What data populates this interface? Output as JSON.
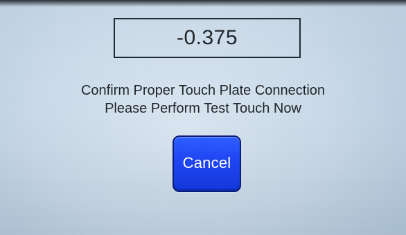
{
  "display": {
    "value": "-0.375"
  },
  "message": {
    "line1": "Confirm Proper Touch Plate Connection",
    "line2": "Please Perform Test Touch Now"
  },
  "actions": {
    "cancel_label": "Cancel"
  },
  "colors": {
    "screen_background": "#c9d9e8",
    "text": "#1f2328",
    "value_box_border": "#1e2a33",
    "button_fill": "#1e44f2",
    "button_border": "#0a1d73",
    "button_text": "#ffffff"
  }
}
